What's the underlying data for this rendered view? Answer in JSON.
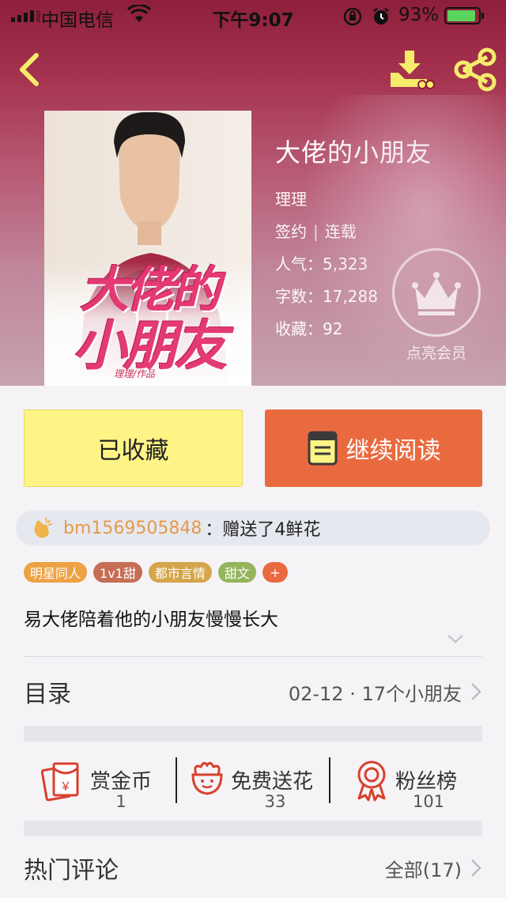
{
  "status_bar": {
    "carrier": "中国电信",
    "time": "下午9:07",
    "battery": "93%",
    "battery_level": 0.93
  },
  "nav": {
    "back_icon": "chevron-left-icon",
    "download_icon": "download-icon",
    "share_icon": "share-icon"
  },
  "book": {
    "cover_title_line1": "大佬的",
    "cover_title_line2": "小朋友",
    "cover_author_mark": "理理/作品",
    "title": "大佬的小朋友",
    "author": "理理",
    "contract": "签约",
    "serial_status": "连载",
    "popularity_label": "人气：",
    "popularity": "5,323",
    "words_label": "字数：",
    "words": "17,288",
    "favorites_label": "收藏：",
    "favorites": "92"
  },
  "vip": {
    "label": "点亮会员"
  },
  "actions": {
    "favorite_label": "已收藏",
    "read_label": "继续阅读"
  },
  "gift": {
    "user": "bm1569505848",
    "message": "：赠送了4鲜花"
  },
  "tags": [
    {
      "label": "明星同人",
      "color": "#eda244"
    },
    {
      "label": "1v1甜",
      "color": "#c66d54"
    },
    {
      "label": "都市言情",
      "color": "#d4a54a"
    },
    {
      "label": "甜文",
      "color": "#94b55b"
    },
    {
      "label": "+",
      "color": "#ea6a3f"
    }
  ],
  "summary": "易大佬陪着他的小朋友慢慢长大",
  "toc": {
    "title": "目录",
    "latest": "02-12 · 17个小朋友"
  },
  "stats": [
    {
      "label": "赏金币",
      "value": "1",
      "icon": "red-envelope-icon"
    },
    {
      "label": "免费送花",
      "value": "33",
      "icon": "flower-icon"
    },
    {
      "label": "粉丝榜",
      "value": "101",
      "icon": "medal-icon"
    }
  ],
  "comments": {
    "title": "热门评论",
    "all": "全部(17)"
  },
  "colors": {
    "accent_orange": "#ea6a3f",
    "fav_yellow": "#fef486",
    "icon_red": "#d8402d"
  }
}
